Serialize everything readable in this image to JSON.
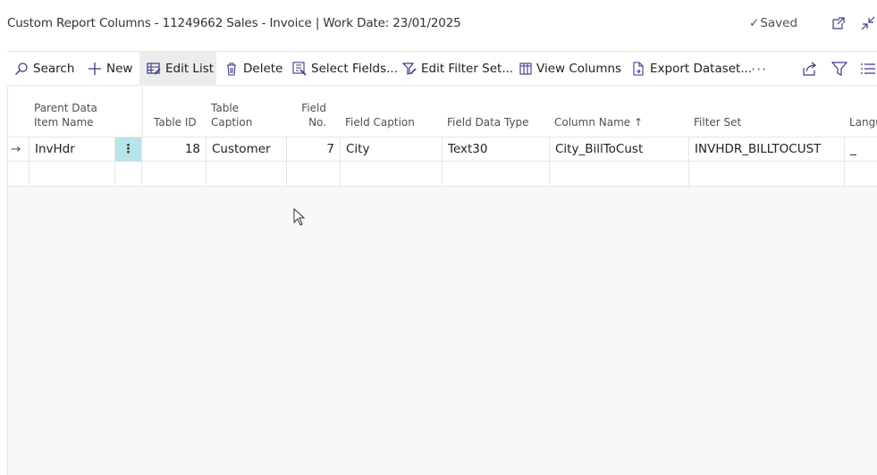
{
  "window": {
    "title": "Custom Report Columns - 11249662 Sales - Invoice | Work Date: 23/01/2025",
    "saved_label": "Saved"
  },
  "toolbar": {
    "search": "Search",
    "new": "New",
    "edit_list": "Edit List",
    "delete": "Delete",
    "select_fields": "Select Fields...",
    "edit_filter_set": "Edit Filter Set...",
    "view_columns": "View Columns",
    "export_dataset": "Export Dataset...",
    "more": "···"
  },
  "table": {
    "headers": {
      "parent_line1": "Parent Data",
      "parent_line2": "Item Name",
      "table_id": "Table ID",
      "table_caption_line1": "Table",
      "table_caption_line2": "Caption",
      "field_no_line1": "Field",
      "field_no_line2": "No.",
      "field_caption": "Field Caption",
      "field_data_type": "Field Data Type",
      "column_name": "Column Name",
      "sort_arrow": "↑",
      "filter_set": "Filter Set",
      "language": "Langu"
    },
    "rows": [
      {
        "selector": "→",
        "parent": "InvHdr",
        "table_id": "18",
        "table_caption": "Customer",
        "field_no": "7",
        "field_caption": "City",
        "field_data_type": "Text30",
        "column_name": "City_BillToCust",
        "filter_set": "INVHDR_BILLTOCUST",
        "language": "_"
      }
    ]
  },
  "colors": {
    "accent": "#b7e4ea",
    "icon": "#3a3a8a"
  }
}
